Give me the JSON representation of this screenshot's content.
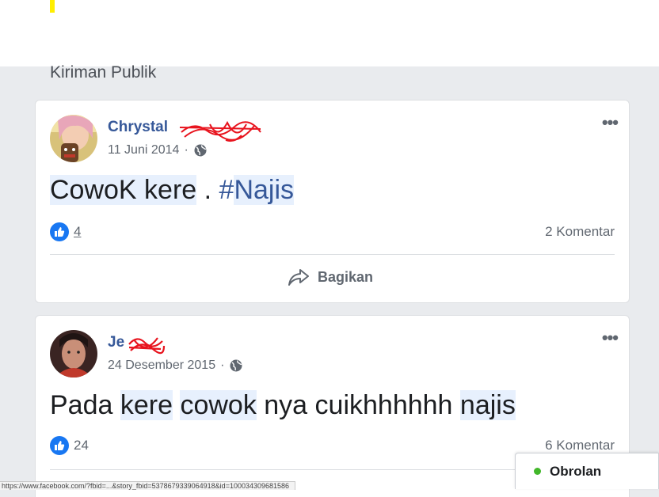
{
  "section": {
    "title": "Kiriman Publik"
  },
  "posts": [
    {
      "author": "Chrystal",
      "date": "11 Juni 2014",
      "separator": "·",
      "privacy_icon": "globe-icon",
      "text_parts": [
        "CowoK kere",
        " . ",
        "#",
        "Najis"
      ],
      "reaction_icon": "like-icon",
      "reaction_count": "4",
      "comments": "2 Komentar",
      "share_label": "Bagikan",
      "more_label": "•••"
    },
    {
      "author": "Je",
      "date": "24 Desember 2015",
      "separator": "·",
      "privacy_icon": "globe-icon",
      "text_parts": [
        "Pada ",
        "kere",
        " ",
        "cowok",
        " nya cuikhhhhhh ",
        "najis"
      ],
      "reaction_icon": "like-icon",
      "reaction_count": "24",
      "comments": "6 Komentar",
      "more_label": "•••"
    }
  ],
  "chat": {
    "label": "Obrolan",
    "status_color": "#42b72a"
  },
  "status_bar": {
    "url": "https://www.facebook.com/?fbid=...&story_fbid=5378679339064918&id=100034309681586"
  },
  "colors": {
    "link": "#365899",
    "like": "#1877f2",
    "highlight": "#e7f0fd"
  }
}
